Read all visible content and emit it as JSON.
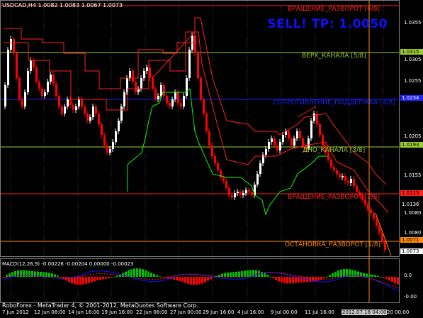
{
  "header": {
    "symbol_line": "USDCAD,H4  1.0082 1.0083 1.0067 1.0073",
    "signal": "SELL!  TP: 1.0050"
  },
  "levels": [
    {
      "label": "ВРАЩЕНИЕ_РАЗВОРОТ [6/8]",
      "color": "#ff2020",
      "tag": "",
      "tag_bg": ""
    },
    {
      "label": "ВЕРХ_КАНАЛА [5/8]",
      "color": "#9acd32",
      "tag": "1.0315",
      "tag_bg": "#9acd32"
    },
    {
      "label": "СОПРОТИВЛЕНИЕ_ПОДДЕРЖКА [4/8]",
      "color": "#2020ff",
      "tag": "1.0234",
      "tag_bg": "#2020ff"
    },
    {
      "label": "ДНО_КАНАЛА [3/8]",
      "color": "#9acd32",
      "tag": "1.0193",
      "tag_bg": "#9acd32"
    },
    {
      "label": "ВРАЩЕНИЕ_РАЗВОРОТ [2/8]",
      "color": "#ff2020",
      "tag": "1.0115",
      "tag_bg": "#ff2020"
    },
    {
      "label": "ОСТАНОВКА_РАЗВОРОТ [1/8]",
      "color": "#ff8c00",
      "tag": "1.0071",
      "tag_bg": "#ff8c00"
    }
  ],
  "price_axis": [
    "1.0355",
    "1.0305",
    "1.0255",
    "1.0205",
    "1.0155",
    "1.0136",
    "1.0080"
  ],
  "time_axis": [
    "7 Jun 2012",
    "12 Jun 08:00",
    "14 Jun 16:00",
    "19 Jun 16:00",
    "22 Jun 08:00",
    "27 Jun 00:00",
    "29 Jun 16:00",
    "4 Jul 16:00",
    "9 Jul 00:00",
    "11 Jul 16:00",
    "2012.07.18 04:00",
    "20 00:00"
  ],
  "macd": {
    "label": "MACD(12,26,9)  -0.00226 -0.00204 0.00000 -0.00023",
    "axis": [
      "0.0",
      "-0.00"
    ]
  },
  "footer": "RoboForex - MetaTrader 4, © 2001-2012, MetaQuotes Software Corp.",
  "colors": {
    "bull": "#ffffff",
    "bear": "#ff0000",
    "envelope": "#ff2020",
    "support": "#00ff00",
    "grid": "#3a3a3a",
    "hist_pos": "#00c000",
    "hist_neg": "#ff0000"
  }
}
